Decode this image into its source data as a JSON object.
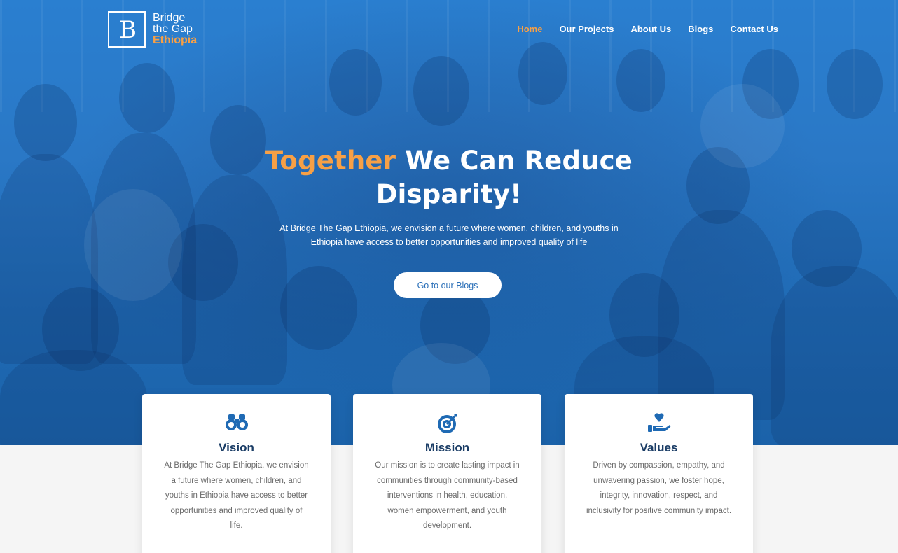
{
  "brand": {
    "line1": "Bridge",
    "line2": "the Gap",
    "line3": "Ethiopia",
    "mark": "B",
    "accent_color": "#f7a046",
    "hero_color": "#2a78c6"
  },
  "nav": {
    "items": [
      {
        "label": "Home",
        "active": true
      },
      {
        "label": "Our Projects",
        "active": false
      },
      {
        "label": "About Us",
        "active": false
      },
      {
        "label": "Blogs",
        "active": false
      },
      {
        "label": "Contact Us",
        "active": false
      }
    ]
  },
  "hero": {
    "headline_accent": "Together",
    "headline_rest": " We Can Reduce",
    "headline_line2": "Disparity!",
    "subtext": "At Bridge The Gap Ethiopia, we envision a future where women, children, and youths in Ethiopia have access to better opportunities and improved quality of life",
    "cta_label": "Go to our Blogs"
  },
  "cards": [
    {
      "icon": "binoculars-icon",
      "title": "Vision",
      "text": "At Bridge The Gap Ethiopia, we envision a future where women, children, and youths in Ethiopia have access to better opportunities and improved quality of life."
    },
    {
      "icon": "target-icon",
      "title": "Mission",
      "text": "Our mission is to create lasting impact in communities through community-based interventions in health, education, women empowerment, and youth development."
    },
    {
      "icon": "heart-hand-icon",
      "title": "Values",
      "text": "Driven by compassion, empathy, and unwavering passion, we foster hope, integrity, innovation, respect, and inclusivity for positive community impact."
    }
  ]
}
